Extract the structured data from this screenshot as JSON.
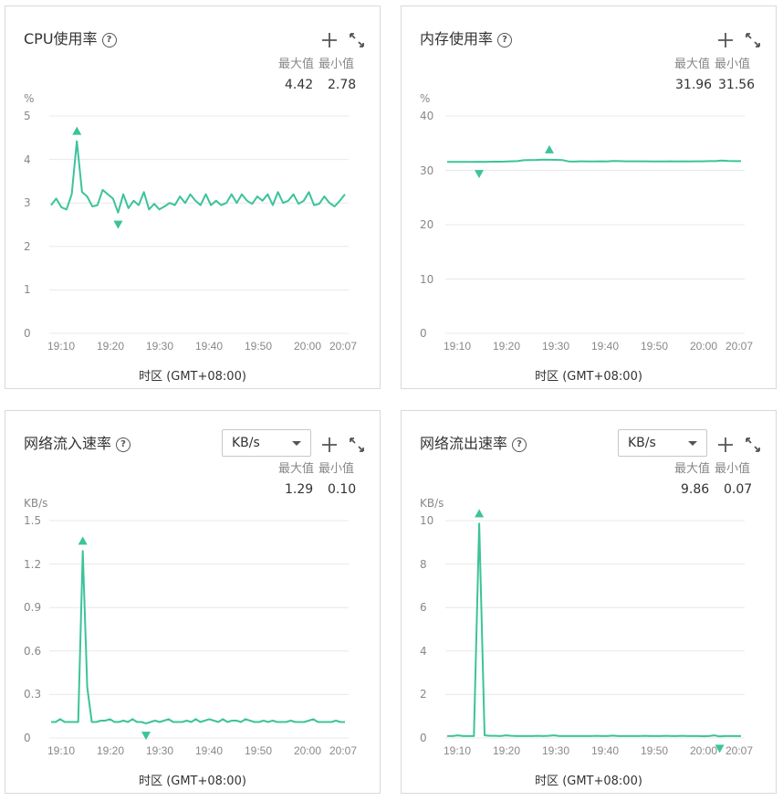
{
  "panels": [
    {
      "title": "CPU使用率",
      "max_label": "最大值",
      "min_label": "最小值",
      "max": "4.42",
      "min": "2.78",
      "unit": "%",
      "y_ticks": [
        "5",
        "4",
        "3",
        "2",
        "1",
        "0"
      ],
      "timezone": "时区 (GMT+08:00)"
    },
    {
      "title": "内存使用率",
      "max_label": "最大值",
      "min_label": "最小值",
      "max": "31.96",
      "min": "31.56",
      "unit": "%",
      "y_ticks": [
        "40",
        "30",
        "20",
        "10",
        "0"
      ],
      "timezone": "时区 (GMT+08:00)"
    },
    {
      "title": "网络流入速率",
      "dropdown": "KB/s",
      "max_label": "最大值",
      "min_label": "最小值",
      "max": "1.29",
      "min": "0.10",
      "unit": "KB/s",
      "y_ticks": [
        "1.5",
        "1.2",
        "0.9",
        "0.6",
        "0.3",
        "0"
      ],
      "timezone": "时区 (GMT+08:00)"
    },
    {
      "title": "网络流出速率",
      "dropdown": "KB/s",
      "max_label": "最大值",
      "min_label": "最小值",
      "max": "9.86",
      "min": "0.07",
      "unit": "KB/s",
      "y_ticks": [
        "10",
        "8",
        "6",
        "4",
        "2",
        "0"
      ],
      "timezone": "时区 (GMT+08:00)"
    }
  ],
  "chart_data": [
    {
      "type": "line",
      "color": "#3cc39a",
      "x_ticks": [
        "19:10",
        "19:20",
        "19:30",
        "19:40",
        "19:50",
        "20:00",
        "20:07"
      ],
      "ylim": [
        0,
        5
      ],
      "x_start_min": 0,
      "x_end_min": 60,
      "values": [
        2.95,
        3.1,
        2.9,
        2.85,
        3.2,
        4.42,
        3.25,
        3.15,
        2.92,
        2.95,
        3.3,
        3.2,
        3.1,
        2.78,
        3.2,
        2.88,
        3.05,
        2.95,
        3.25,
        2.85,
        2.98,
        2.85,
        2.92,
        3.0,
        2.95,
        3.15,
        3.0,
        3.2,
        3.05,
        2.95,
        3.2,
        2.95,
        3.05,
        2.95,
        3.0,
        3.2,
        3.0,
        3.2,
        3.05,
        2.98,
        3.15,
        3.05,
        3.2,
        2.95,
        3.25,
        3.0,
        3.05,
        3.2,
        2.98,
        3.05,
        3.25,
        2.95,
        2.98,
        3.15,
        3.0,
        2.92,
        3.05,
        3.2
      ],
      "max_marker_index": 5,
      "min_marker_index": 13
    },
    {
      "type": "line",
      "color": "#3cc39a",
      "x_ticks": [
        "19:10",
        "19:20",
        "19:30",
        "19:40",
        "19:50",
        "20:00",
        "20:07"
      ],
      "ylim": [
        0,
        40
      ],
      "values": [
        31.56,
        31.56,
        31.57,
        31.56,
        31.57,
        31.58,
        31.56,
        31.6,
        31.6,
        31.62,
        31.66,
        31.7,
        31.86,
        31.9,
        31.92,
        31.96,
        31.95,
        31.94,
        31.9,
        31.65,
        31.62,
        31.66,
        31.64,
        31.65,
        31.66,
        31.64,
        31.72,
        31.7,
        31.66,
        31.67,
        31.66,
        31.66,
        31.65,
        31.65,
        31.64,
        31.66,
        31.65,
        31.66,
        31.64,
        31.67,
        31.66,
        31.7,
        31.7,
        31.8,
        31.72,
        31.7,
        31.7
      ],
      "max_marker_index": 16,
      "min_marker_index": 5
    },
    {
      "type": "line",
      "color": "#3cc39a",
      "x_ticks": [
        "19:10",
        "19:20",
        "19:30",
        "19:40",
        "19:50",
        "20:00",
        "20:07"
      ],
      "ylim": [
        0,
        1.5
      ],
      "values": [
        0.11,
        0.11,
        0.13,
        0.11,
        0.11,
        0.11,
        0.11,
        1.29,
        0.35,
        0.11,
        0.11,
        0.12,
        0.12,
        0.13,
        0.11,
        0.11,
        0.12,
        0.11,
        0.13,
        0.11,
        0.11,
        0.1,
        0.11,
        0.12,
        0.11,
        0.12,
        0.13,
        0.11,
        0.11,
        0.11,
        0.12,
        0.11,
        0.13,
        0.11,
        0.12,
        0.13,
        0.12,
        0.11,
        0.13,
        0.11,
        0.12,
        0.12,
        0.11,
        0.13,
        0.12,
        0.11,
        0.11,
        0.12,
        0.11,
        0.12,
        0.11,
        0.11,
        0.11,
        0.12,
        0.11,
        0.11,
        0.11,
        0.12,
        0.13,
        0.11,
        0.11,
        0.11,
        0.11,
        0.12,
        0.11,
        0.11
      ],
      "max_marker_index": 7,
      "min_marker_index": 21
    },
    {
      "type": "line",
      "color": "#3cc39a",
      "x_ticks": [
        "19:10",
        "19:20",
        "19:30",
        "19:40",
        "19:50",
        "20:00",
        "20:07"
      ],
      "ylim": [
        0,
        10
      ],
      "values": [
        0.09,
        0.09,
        0.12,
        0.09,
        0.09,
        0.09,
        9.86,
        0.12,
        0.1,
        0.1,
        0.09,
        0.12,
        0.1,
        0.09,
        0.09,
        0.09,
        0.09,
        0.1,
        0.09,
        0.1,
        0.12,
        0.09,
        0.09,
        0.09,
        0.09,
        0.09,
        0.09,
        0.09,
        0.1,
        0.09,
        0.09,
        0.11,
        0.09,
        0.09,
        0.09,
        0.09,
        0.09,
        0.1,
        0.09,
        0.09,
        0.09,
        0.1,
        0.09,
        0.09,
        0.1,
        0.09,
        0.09,
        0.09,
        0.08,
        0.09,
        0.12,
        0.07,
        0.09,
        0.09,
        0.09,
        0.09
      ],
      "max_marker_index": 6,
      "min_marker_index": 51
    }
  ]
}
